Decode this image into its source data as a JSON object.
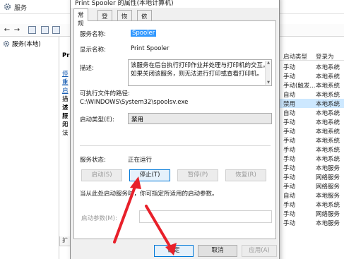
{
  "services_window": {
    "title": "服务",
    "tree_item": "服务(本地)",
    "columns": {
      "startup_type": "启动类型",
      "logon_as": "登录为"
    },
    "desc_fragments": [
      "Pri",
      "停止",
      "重启",
      "描述",
      "该服",
      "打印",
      "无法"
    ],
    "rows": [
      {
        "startup": "手动",
        "logon": "本地系统"
      },
      {
        "startup": "手动",
        "logon": "本地系统"
      },
      {
        "startup": "手动(触发...",
        "logon": "本地系统"
      },
      {
        "startup": "自动",
        "logon": "本地系统"
      },
      {
        "startup": "禁用",
        "logon": "本地系统"
      },
      {
        "startup": "自动",
        "logon": "本地系统"
      },
      {
        "startup": "手动",
        "logon": "本地系统"
      },
      {
        "startup": "手动",
        "logon": "本地系统"
      },
      {
        "startup": "手动",
        "logon": "本地系统"
      },
      {
        "startup": "手动",
        "logon": "本地系统"
      },
      {
        "startup": "手动",
        "logon": "本地系统"
      },
      {
        "startup": "手动",
        "logon": "本地服务"
      },
      {
        "startup": "手动",
        "logon": "网络服务"
      },
      {
        "startup": "手动",
        "logon": "网络服务"
      },
      {
        "startup": "自动",
        "logon": "本地服务"
      },
      {
        "startup": "手动",
        "logon": "本地系统"
      },
      {
        "startup": "手动",
        "logon": "网络服务"
      },
      {
        "startup": "手动",
        "logon": "本地服务"
      }
    ],
    "bottom_tab": "扩"
  },
  "dialog": {
    "title": "Print Spooler 的属性(本地计算机)",
    "tabs": [
      "常规",
      "登录",
      "恢复",
      "依存关系"
    ],
    "active_tab": "常规",
    "service_name_label": "服务名称:",
    "service_name": "Spooler",
    "display_name_label": "显示名称:",
    "display_name": "Print Spooler",
    "description_label": "描述:",
    "description": "该服务在后台执行打印作业并处理与打印机的交互。如果关闭该服务，则无法进行打印或查看打印机。",
    "exe_path_label": "可执行文件的路径:",
    "exe_path": "C:\\WINDOWS\\System32\\spoolsv.exe",
    "startup_type_label": "启动类型(E):",
    "startup_type_value": "禁用",
    "service_status_label": "服务状态:",
    "service_status": "正在运行",
    "buttons": {
      "start": "启动(S)",
      "stop": "停止(T)",
      "pause": "暂停(P)",
      "resume": "恢复(R)"
    },
    "hint": "当从此处启动服务时，你可指定所适用的启动参数。",
    "start_params_label": "启动参数(M):",
    "footer": {
      "ok": "确定",
      "cancel": "取消",
      "apply": "应用(A)"
    }
  },
  "colors": {
    "accent": "#0078d7",
    "selection": "#3399ff",
    "annotation_arrow": "#e8202a"
  }
}
